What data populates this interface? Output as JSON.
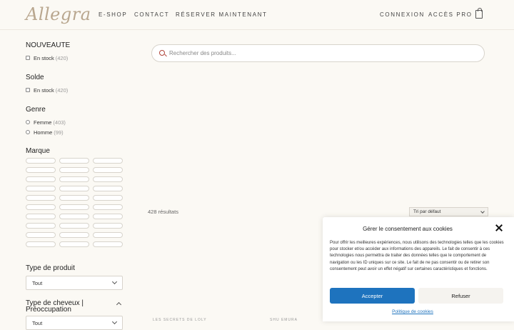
{
  "header": {
    "logo": "Allegra",
    "nav_left": [
      "E-SHOP",
      "CONTACT",
      "RÉSERVER MAINTENANT"
    ],
    "nav_right": [
      "CONNEXION",
      "ACCÈS PRO"
    ],
    "cart_icon": "shopping-bag-icon"
  },
  "sidebar": {
    "nouveaute": {
      "title": "NOUVEAUTE",
      "option": "En stock",
      "count": "(420)"
    },
    "solde": {
      "title": "Solde",
      "option": "En stock",
      "count": "(420)"
    },
    "genre": {
      "title": "Genre",
      "options": [
        {
          "label": "Femme",
          "count": "(403)"
        },
        {
          "label": "Homme",
          "count": "(99)"
        }
      ]
    },
    "marque": {
      "title": "Marque"
    },
    "type_produit": {
      "title": "Type de produit",
      "value": "Tout"
    },
    "type_cheveux": {
      "title": "Type de cheveux | Préoccupation",
      "value": "Tout"
    }
  },
  "search": {
    "placeholder": "Rechercher des produits..."
  },
  "results": {
    "count": "428 résultats",
    "sort": "Tri par défaut"
  },
  "footer_hints": [
    "LES SECRETS DE LOLY",
    "SHU EMURA"
  ],
  "cookie": {
    "title": "Gérer le consentement aux cookies",
    "text": "Pour offrir les meilleures expériences, nous utilisons des technologies telles que les cookies pour stocker et/ou accéder aux informations des appareils. Le fait de consentir à ces technologies nous permettra de traiter des données telles que le comportement de navigation ou les ID uniques sur ce site. Le fait de ne pas consentir ou de retirer son consentement peut avoir un effet négatif sur certaines caractéristiques et fonctions.",
    "accept": "Accepter",
    "refuse": "Refuser",
    "policy": "Politique de cookies",
    "accent": "#1e73be"
  }
}
